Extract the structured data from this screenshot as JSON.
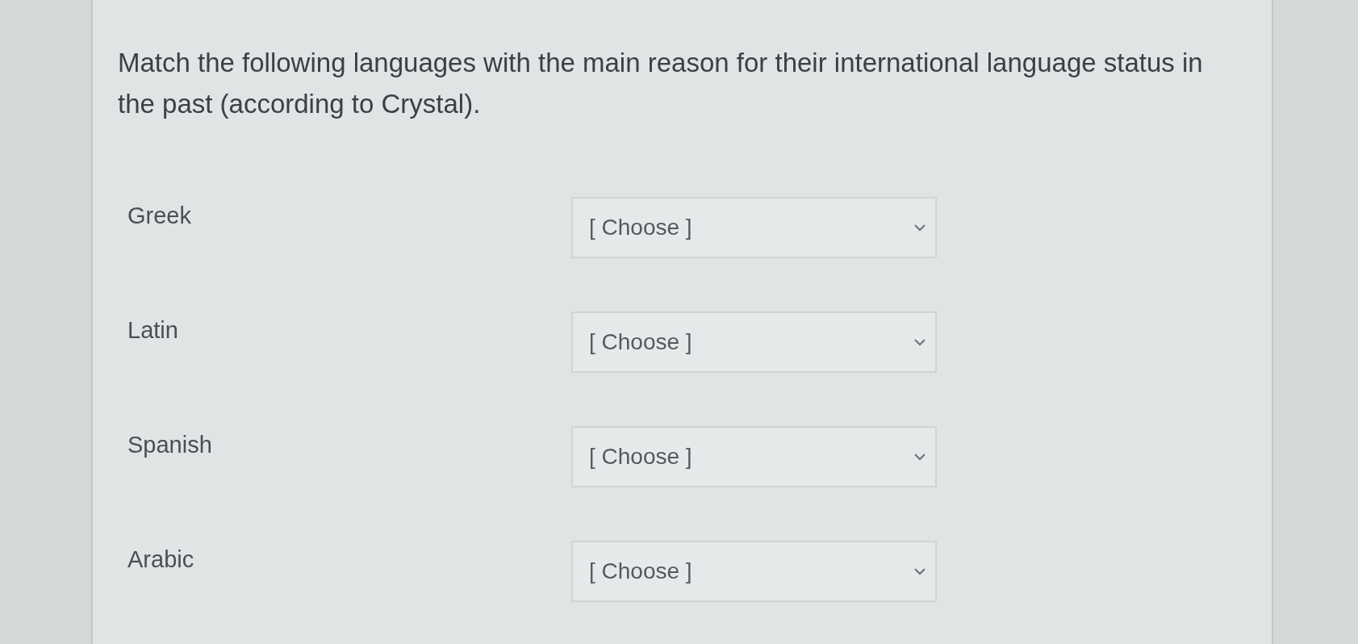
{
  "question": "Match the following languages with the main reason for their international language status in the past (according to Crystal).",
  "matches": [
    {
      "label": "Greek",
      "selection": "[ Choose ]"
    },
    {
      "label": "Latin",
      "selection": "[ Choose ]"
    },
    {
      "label": "Spanish",
      "selection": "[ Choose ]"
    },
    {
      "label": "Arabic",
      "selection": "[ Choose ]"
    }
  ]
}
